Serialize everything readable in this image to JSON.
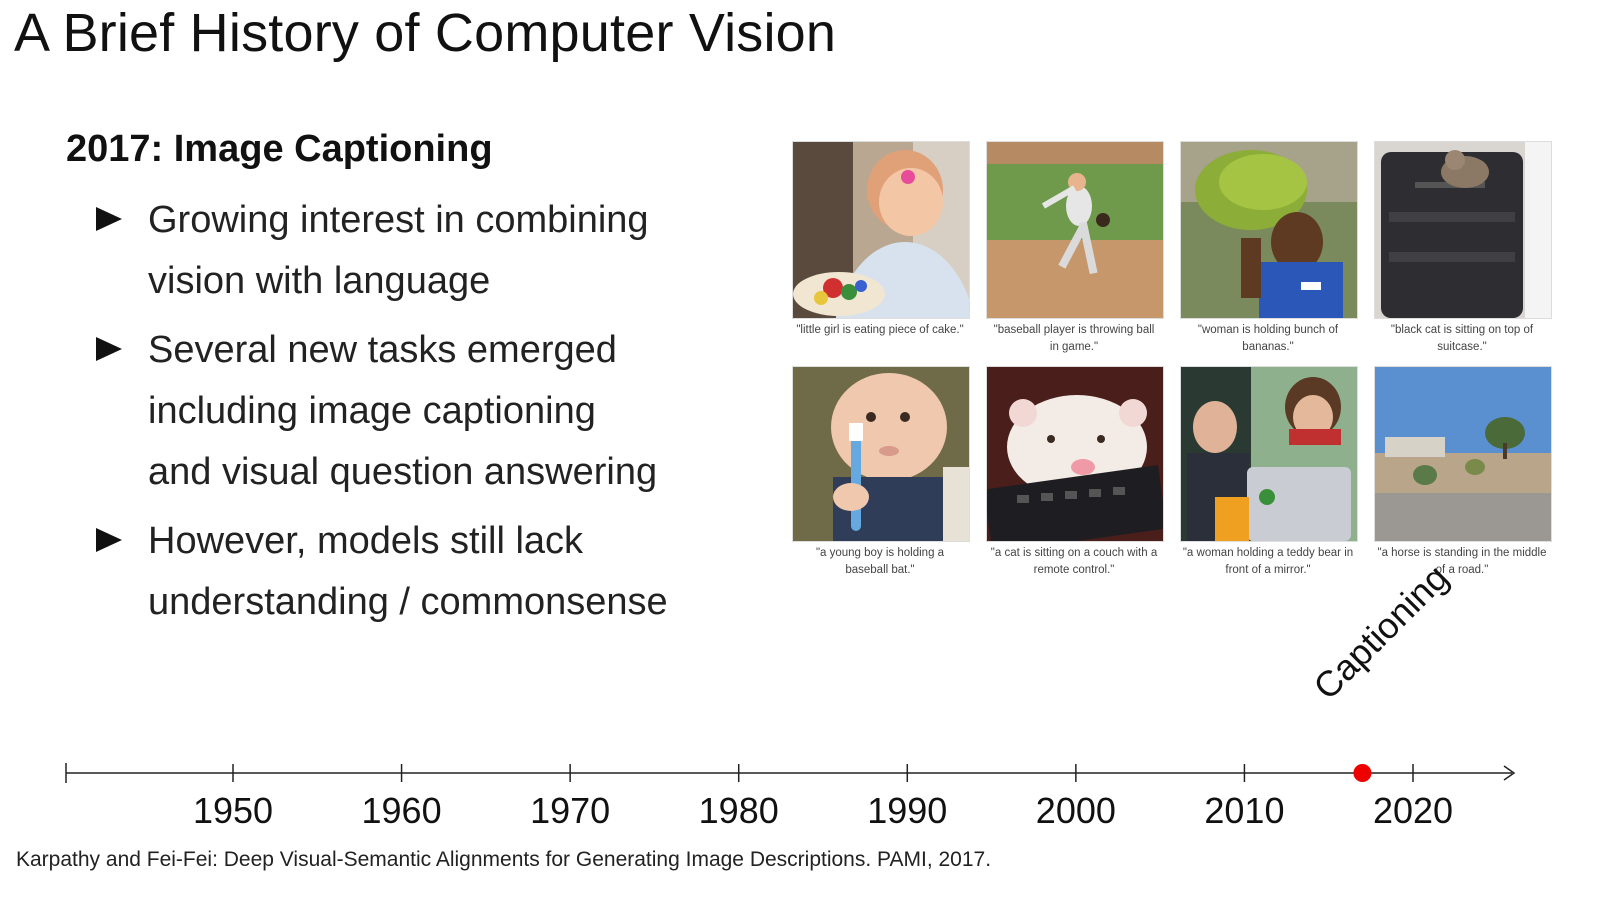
{
  "slide": {
    "title": "A Brief History of Computer Vision",
    "subtitle": "2017: Image Captioning",
    "bullets": [
      {
        "lines": [
          "Growing interest in combining",
          "vision with language"
        ]
      },
      {
        "lines": [
          "Several new tasks emerged",
          "including image captioning",
          "and visual question answering"
        ]
      },
      {
        "lines": [
          "However, models still lack",
          "understanding / commonsense"
        ]
      }
    ],
    "reference": "Karpathy and Fei-Fei: Deep Visual-Semantic Alignments for Generating Image Descriptions. PAMI, 2017."
  },
  "grid": {
    "items": [
      {
        "caption_lines": [
          "\"little girl is eating piece of cake.\""
        ],
        "icon": "girl-with-cake-photo"
      },
      {
        "caption_lines": [
          "\"baseball player is throwing ball",
          "in game.\""
        ],
        "icon": "baseball-pitcher-photo"
      },
      {
        "caption_lines": [
          "\"woman is holding bunch of",
          "bananas.\""
        ],
        "icon": "woman-with-bananas-photo"
      },
      {
        "caption_lines": [
          "\"black cat is sitting on top of",
          "suitcase.\""
        ],
        "icon": "cat-on-suitcase-photo"
      },
      {
        "caption_lines": [
          "\"a young boy is holding a",
          "baseball bat.\""
        ],
        "icon": "baby-with-toothbrush-photo"
      },
      {
        "caption_lines": [
          "\"a cat is sitting on a couch with a",
          "remote control.\""
        ],
        "icon": "ferret-on-remote-photo"
      },
      {
        "caption_lines": [
          "\"a woman holding a teddy bear in",
          "front of a mirror.\""
        ],
        "icon": "people-with-laptop-photo"
      },
      {
        "caption_lines": [
          "\"a horse is standing in the middle",
          "of a road.\""
        ],
        "icon": "road-landscape-photo"
      }
    ]
  },
  "timeline": {
    "years": [
      "1950",
      "1960",
      "1970",
      "1980",
      "1990",
      "2000",
      "2010",
      "2020"
    ],
    "range": [
      1940,
      2026
    ],
    "milestone": {
      "year": 2017,
      "label": "Captioning",
      "color": "#ee0000"
    }
  }
}
